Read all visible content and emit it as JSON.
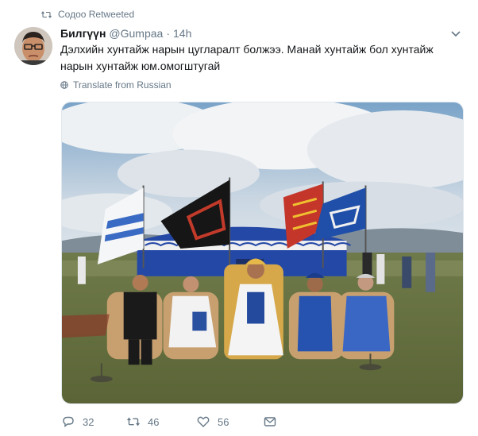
{
  "retweet": {
    "label": "Содоо Retweeted",
    "icon": "retweet-icon"
  },
  "author": {
    "name": "Билгүүн",
    "handle": "@Gumpaa",
    "separator": "·",
    "time": "14h",
    "avatar_icon": "avatar"
  },
  "tweet": {
    "text_line1": "Дэлхийн хунтайж нарын цугларалт болжээ. Манай хунтайж бол хунтайж",
    "text_line2": "нарын хунтайж юм.омогштугай",
    "translate_label": "Translate from Russian",
    "menu_icon": "chevron-down-icon"
  },
  "media": {
    "kind": "photo",
    "description_icon": "photo"
  },
  "actions": {
    "reply_count": "32",
    "retweet_count": "46",
    "like_count": "56",
    "icons": [
      "reply-icon",
      "retweet-icon",
      "like-icon",
      "message-icon"
    ]
  },
  "colors": {
    "text": "#14171a",
    "muted": "#657786",
    "border": "#e1e8ed",
    "accent": "#1da1f2"
  }
}
